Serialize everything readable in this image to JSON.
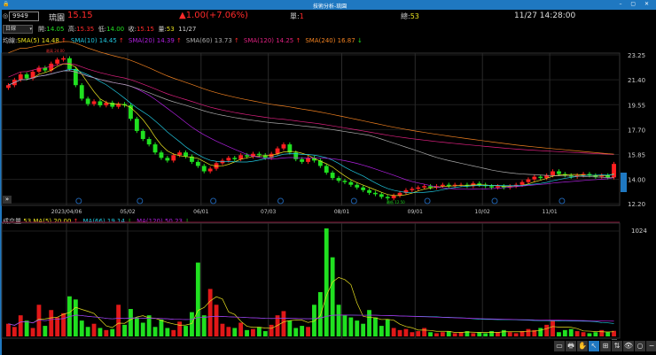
{
  "window": {
    "title": "技術分析-琉園",
    "controls": "– ▢ ✕"
  },
  "header": {
    "code": "9949",
    "name": "琉園",
    "price": "15.15",
    "change": "▲1.00(+7.06%)",
    "unit_label": "單:",
    "unit_value": "1",
    "total_label": "總:",
    "total_value": "53",
    "datetime": "11/27 14:28:00"
  },
  "quote": {
    "period": "日線",
    "open_label": "開:",
    "open": "14.05",
    "high_label": "高:",
    "high": "15.35",
    "low_label": "低:",
    "low": "14.00",
    "close_label": "收:",
    "close": "15.15",
    "vol_label": "量:",
    "vol": "53",
    "date": "11/27"
  },
  "ma_legend": {
    "label": "均線:",
    "items": [
      {
        "text": "SMA(5) 14.48",
        "arrow": "↑",
        "color": "#e8e020"
      },
      {
        "text": "SMA(10) 14.45",
        "arrow": "↑",
        "color": "#20c8e0"
      },
      {
        "text": "SMA(20) 14.39",
        "arrow": "↑",
        "color": "#b020e0"
      },
      {
        "text": "SMA(60) 13.73",
        "arrow": "↑",
        "color": "#aaaaaa"
      },
      {
        "text": "SMA(120) 14.25",
        "arrow": "↑",
        "color": "#e02080"
      },
      {
        "text": "SMA(240) 16.87",
        "arrow": "↓",
        "color": "#f08020"
      }
    ]
  },
  "vol_legend": {
    "label": "成交量",
    "value": "53",
    "items": [
      {
        "text": "MA(5) 20.00",
        "arrow": "↑",
        "color": "#e8e020"
      },
      {
        "text": "MA(66) 19.14",
        "arrow": "↓",
        "color": "#20c8e0"
      },
      {
        "text": "MA(120) 50.23",
        "arrow": "↓",
        "color": "#b020e0"
      }
    ]
  },
  "annotations": {
    "high": "最高 24.00",
    "low": "最低 12.50"
  },
  "toolbar": [
    "▭",
    "🖶",
    "✋",
    "↖",
    "⊞",
    "⇅",
    "👁",
    "○",
    "−",
    "+"
  ],
  "chart_data": {
    "type": "candlestick",
    "price_ticks": [
      "23.25",
      "21.40",
      "19.55",
      "17.70",
      "15.85",
      "14.00",
      "12.20"
    ],
    "ylim": [
      12.2,
      23.25
    ],
    "vol_ticks": [
      "1024"
    ],
    "date_labels": [
      {
        "i": 10,
        "t": "2023/04/06"
      },
      {
        "i": 20,
        "t": "05/02"
      },
      {
        "i": 32,
        "t": "06/01"
      },
      {
        "i": 43,
        "t": "07/03"
      },
      {
        "i": 55,
        "t": "08/01"
      },
      {
        "i": 67,
        "t": "09/01"
      },
      {
        "i": 78,
        "t": "10/02"
      },
      {
        "i": 89,
        "t": "11/01"
      }
    ],
    "close": [
      21.0,
      21.4,
      21.8,
      21.5,
      22.0,
      22.3,
      22.1,
      22.6,
      22.9,
      23.0,
      22.2,
      21.0,
      20.0,
      19.6,
      19.8,
      19.5,
      19.7,
      19.4,
      19.6,
      19.5,
      18.5,
      17.6,
      17.0,
      16.6,
      16.0,
      15.6,
      15.4,
      15.8,
      16.0,
      15.7,
      15.3,
      15.0,
      14.6,
      14.8,
      15.2,
      15.4,
      15.6,
      15.5,
      15.8,
      15.7,
      15.9,
      15.8,
      15.6,
      15.9,
      16.3,
      16.6,
      16.0,
      15.5,
      15.3,
      15.6,
      15.4,
      15.0,
      14.5,
      14.1,
      13.9,
      13.8,
      13.6,
      13.4,
      13.2,
      13.0,
      12.9,
      12.7,
      12.6,
      12.8,
      13.0,
      13.2,
      13.3,
      13.4,
      13.5,
      13.4,
      13.5,
      13.6,
      13.5,
      13.6,
      13.6,
      13.5,
      13.7,
      13.6,
      13.5,
      13.4,
      13.5,
      13.4,
      13.5,
      13.6,
      13.8,
      14.0,
      14.2,
      14.1,
      14.3,
      14.6,
      14.4,
      14.3,
      14.2,
      14.3,
      14.4,
      14.3,
      14.2,
      14.3,
      14.15,
      15.15
    ],
    "volume": [
      120,
      90,
      200,
      150,
      80,
      300,
      100,
      250,
      180,
      220,
      380,
      350,
      150,
      90,
      120,
      80,
      60,
      70,
      300,
      110,
      260,
      180,
      130,
      200,
      90,
      160,
      80,
      60,
      140,
      100,
      230,
      700,
      200,
      450,
      300,
      120,
      90,
      80,
      130,
      60,
      70,
      90,
      50,
      110,
      200,
      240,
      150,
      80,
      100,
      90,
      300,
      420,
      1024,
      750,
      300,
      200,
      180,
      150,
      120,
      250,
      180,
      100,
      160,
      80,
      60,
      70,
      40,
      50,
      80,
      40,
      30,
      40,
      50,
      30,
      40,
      50,
      30,
      40,
      30,
      50,
      40,
      60,
      40,
      30,
      50,
      70,
      60,
      80,
      110,
      150,
      40,
      60,
      70,
      50,
      40,
      30,
      40,
      60,
      40,
      53
    ]
  }
}
